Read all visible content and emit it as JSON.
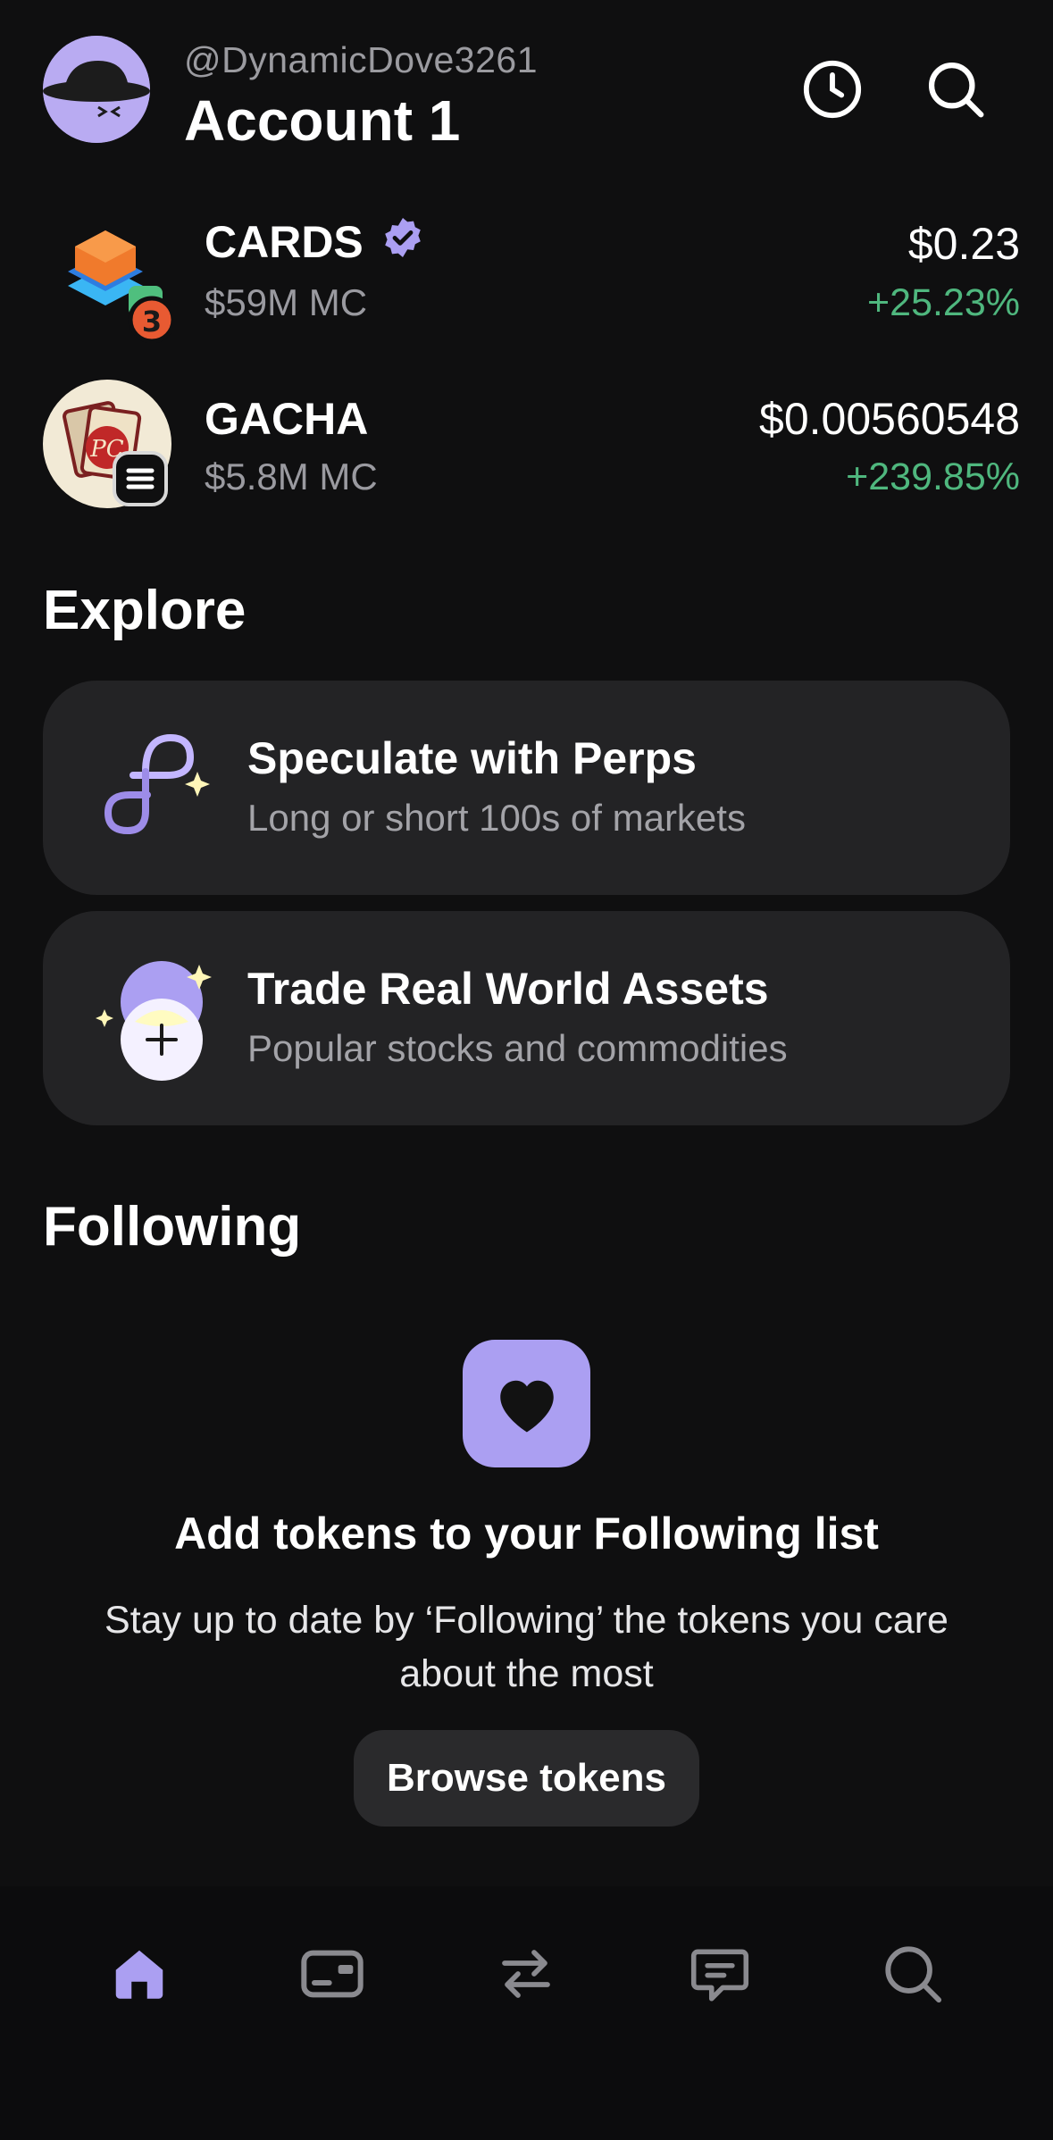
{
  "header": {
    "username": "@DynamicDove3261",
    "account_name": "Account 1",
    "icons": [
      "clock-icon",
      "search-icon"
    ]
  },
  "tokens": [
    {
      "name": "CARDS",
      "verified": true,
      "market_cap": "$59M MC",
      "price": "$0.23",
      "change": "+25.23%",
      "badge_number": "3"
    },
    {
      "name": "GACHA",
      "verified": false,
      "market_cap": "$5.8M MC",
      "price": "$0.00560548",
      "change": "+239.85%",
      "logo_text": "PC"
    }
  ],
  "explore": {
    "title": "Explore",
    "cards": [
      {
        "title": "Speculate with Perps",
        "subtitle": "Long or short 100s of markets",
        "icon": "perps-icon"
      },
      {
        "title": "Trade Real World Assets",
        "subtitle": "Popular stocks and commodities",
        "icon": "rwa-icon"
      }
    ]
  },
  "following": {
    "title": "Following",
    "empty_title": "Add tokens to your Following list",
    "empty_desc": "Stay up to date by ‘Following’ the tokens you care about the most",
    "button_label": "Browse tokens",
    "icon": "heart-icon"
  },
  "nav": {
    "items": [
      "home-icon",
      "wallet-icon",
      "swap-icon",
      "chat-icon",
      "search-icon"
    ],
    "active": "home-icon"
  },
  "colors": {
    "accent": "#ab9ff2",
    "positive": "#4fb77e",
    "background": "#0f0f10",
    "card": "#232325"
  }
}
